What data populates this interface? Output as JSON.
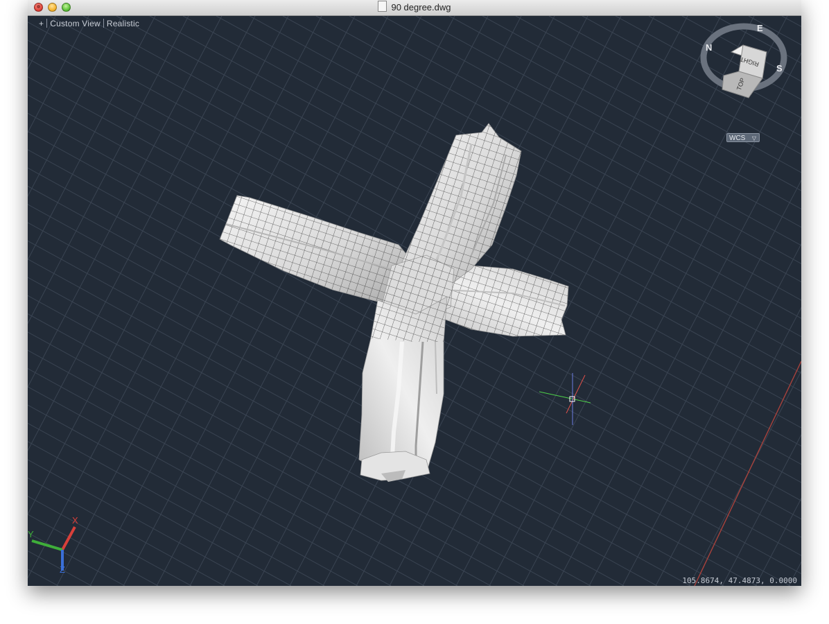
{
  "window": {
    "title": "90 degree.dwg"
  },
  "view_controls": {
    "viewport_menu": "+",
    "view_name": "Custom View",
    "visual_style": "Realistic"
  },
  "viewcube": {
    "compass": {
      "n": "N",
      "e": "E",
      "s": "S"
    },
    "faces": {
      "right": "RIGHT",
      "top": "TOP"
    }
  },
  "wcs_menu": {
    "label": "WCS"
  },
  "ucs_icon": {
    "x": "X",
    "y": "Y",
    "z": "Z"
  },
  "status": {
    "coordinates": "105.8674, 47.4873, 0.0000"
  },
  "colors": {
    "viewport_bg": "#222b37",
    "grid": "#3a4452",
    "model": "#e8e8e8",
    "axis_x": "#d8403a",
    "axis_y": "#3fae3a",
    "axis_z": "#3a6fd8"
  }
}
